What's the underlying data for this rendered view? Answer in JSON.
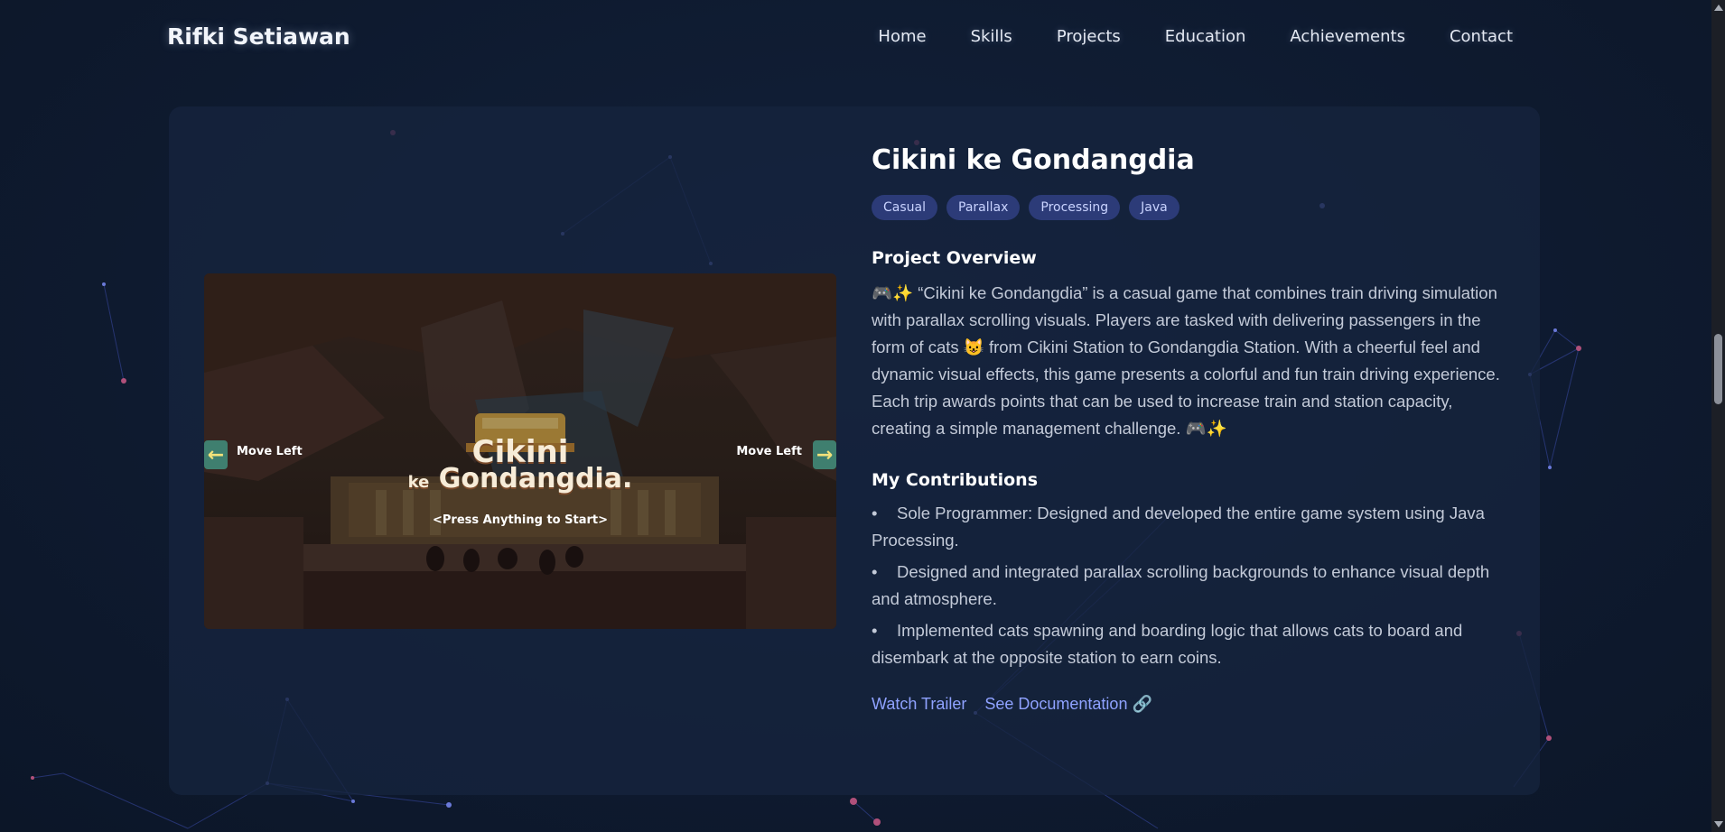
{
  "brand": "Rifki Setiawan",
  "nav": [
    "Home",
    "Skills",
    "Projects",
    "Education",
    "Achievements",
    "Contact"
  ],
  "project": {
    "title": "Cikini ke Gondangdia",
    "tags": [
      "Casual",
      "Parallax",
      "Processing",
      "Java"
    ],
    "overview_heading": "Project Overview",
    "overview_text": "🎮✨ “Cikini ke Gondangdia” is a casual game that combines train driving simulation with parallax scrolling visuals. Players are tasked with delivering passengers in the form of cats 😺 from Cikini Station to Gondangdia Station. With a cheerful feel and dynamic visual effects, this game presents a colorful and fun train driving experience. Each trip awards points that can be used to increase train and station capacity, creating a simple management challenge. 🎮✨",
    "contributions_heading": "My Contributions",
    "contributions": [
      "Sole Programmer: Designed and developed the entire game system using Java Processing.",
      "Designed and integrated parallax scrolling backgrounds to enhance visual depth and atmosphere.",
      "Implemented cats spawning and boarding logic that allows cats to board and disembark at the opposite station to earn coins."
    ],
    "links": {
      "trailer": "Watch Trailer",
      "docs": "See Documentation 🔗"
    }
  },
  "game_screen": {
    "left_caption": "Move Left",
    "right_caption": "Move Left",
    "title_line1": "Cikini",
    "title_ke": "ke",
    "title_line2": "Gondangdia.",
    "press_prompt": "<Press Anything to Start>"
  },
  "colors": {
    "background": "#0f1a2e",
    "card": "#16243e",
    "tag_bg": "#2c3b78",
    "link": "#8fa2ff"
  }
}
